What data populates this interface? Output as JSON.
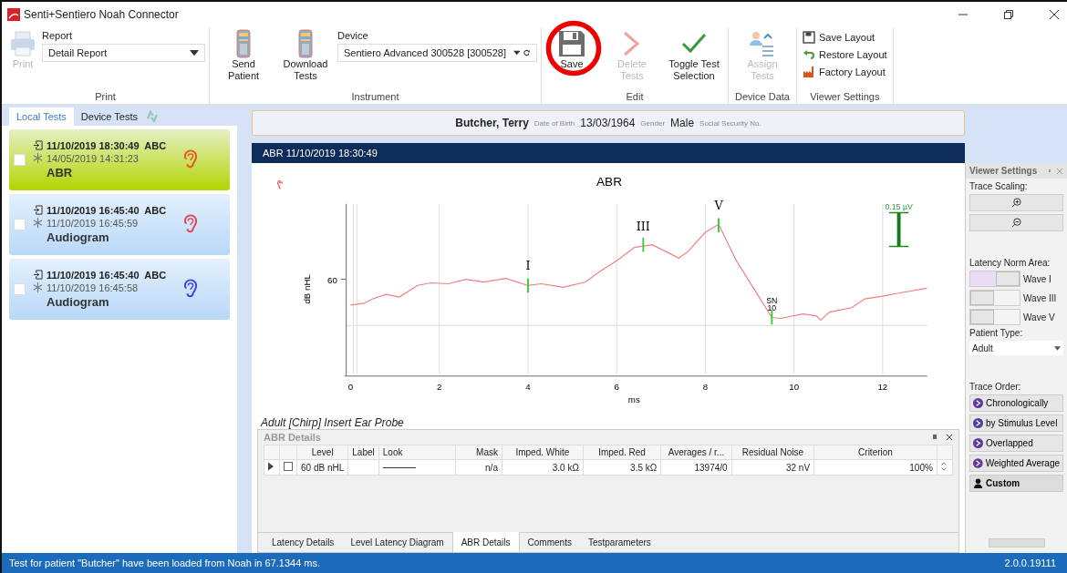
{
  "window": {
    "title": "Senti+Sentiero Noah Connector"
  },
  "ribbon": {
    "groups": [
      {
        "label": "Print",
        "items": [
          {
            "kind": "print",
            "label": "Print",
            "disabled": true
          },
          {
            "kind": "dropdown",
            "caption": "Report",
            "value": "Detail Report"
          }
        ]
      },
      {
        "label": "Instrument",
        "items": [
          {
            "kind": "device",
            "label": "Send Patient",
            "disabled": false
          },
          {
            "kind": "device",
            "label": "Download Tests",
            "disabled": false
          },
          {
            "kind": "dropdown",
            "caption": "Device",
            "value": "Sentiero Advanced 300528 [300528]"
          }
        ]
      },
      {
        "label": "Edit",
        "items": [
          {
            "kind": "save",
            "label": "Save",
            "disabled": false
          },
          {
            "kind": "delete",
            "label": "Delete Tests",
            "disabled": true
          },
          {
            "kind": "check",
            "label": "Toggle Test Selection",
            "disabled": false
          }
        ]
      },
      {
        "label": "Device Data",
        "items": [
          {
            "kind": "assign",
            "label": "Assign Tests",
            "disabled": true
          }
        ]
      },
      {
        "label": "Viewer Settings",
        "items": [
          {
            "kind": "list",
            "entries": [
              {
                "kind": "save",
                "label": "Save Layout"
              },
              {
                "kind": "undo",
                "label": "Restore Layout"
              },
              {
                "kind": "factory",
                "label": "Factory Layout"
              }
            ]
          }
        ]
      }
    ]
  },
  "side_tabs": [
    {
      "label": "Local Tests",
      "selected": true
    },
    {
      "label": "Device Tests",
      "selected": false
    }
  ],
  "tests": [
    {
      "imported": "11/10/2019 18:30:49  ABC",
      "created": "14/05/2019 14:31:23",
      "type": "ABR",
      "color": "#e8502a",
      "selected": true,
      "checked": false
    },
    {
      "imported": "11/10/2019 16:45:40  ABC",
      "created": "11/10/2019 16:45:59",
      "type": "Audiogram",
      "color": "#e84050",
      "selected": false,
      "checked": false
    },
    {
      "imported": "11/10/2019 16:45:40  ABC",
      "created": "11/10/2019 16:45:58",
      "type": "Audiogram",
      "color": "#3a40e8",
      "selected": false,
      "checked": false
    }
  ],
  "patient": {
    "name": "Butcher, Terry",
    "dob_label": "Date of Birth",
    "dob": "13/03/1964",
    "gender_label": "Gender",
    "gender": "Male",
    "ssn_label": "Social Security No."
  },
  "viewer": {
    "title": "ABR 11/10/2019 18:30:49",
    "chart_title": "ABR",
    "ylabel": "dB nHL",
    "ytick": "60",
    "xlabel": "ms",
    "xticks": [
      "0",
      "2",
      "4",
      "6",
      "8",
      "10",
      "12"
    ],
    "peaks": [
      {
        "label": "I"
      },
      {
        "label": "III"
      },
      {
        "label": "V"
      },
      {
        "label": "SN",
        "sub": "10"
      }
    ],
    "scale": "0.15 µV",
    "caption": "Adult [Chirp] Insert Ear Probe"
  },
  "details": {
    "title": "ABR Details",
    "columns": [
      "Level",
      "Label",
      "Look",
      "Mask",
      "Imped. White",
      "Imped. Red",
      "Averages / r...",
      "Residual Noise",
      "Criterion"
    ],
    "rows": [
      {
        "checked": false,
        "cells": [
          "60 dB nHL",
          "",
          "",
          "n/a",
          "3.0 kΩ",
          "3.5 kΩ",
          "13974/0",
          "32 nV",
          "100%"
        ]
      }
    ]
  },
  "bottom_tabs": [
    {
      "label": "Latency Details",
      "selected": false
    },
    {
      "label": "Level Latency Diagram",
      "selected": false
    },
    {
      "label": "ABR Details",
      "selected": true
    },
    {
      "label": "Comments",
      "selected": false
    },
    {
      "label": "Testparameters",
      "selected": false
    }
  ],
  "settings": {
    "title": "Viewer Settings",
    "scaling_label": "Trace Scaling:",
    "norm_label": "Latency Norm Area:",
    "waves": [
      {
        "label": "Wave I",
        "on": true
      },
      {
        "label": "Wave III",
        "on": false
      },
      {
        "label": "Wave V",
        "on": false
      }
    ],
    "patient_type_label": "Patient Type:",
    "patient_type": "Adult",
    "order_label": "Trace Order:",
    "orders": [
      {
        "label": "Chronologically",
        "selected": false
      },
      {
        "label": "by Stimulus Level",
        "selected": false
      },
      {
        "label": "Overlapped",
        "selected": false
      },
      {
        "label": "Weighted Average",
        "selected": false
      },
      {
        "label": "Custom",
        "selected": true
      }
    ]
  },
  "status_bar": {
    "message": "Test for patient \"Butcher\" have been loaded from Noah in 67.1344 ms.",
    "version": "2.0.0.19111"
  }
}
